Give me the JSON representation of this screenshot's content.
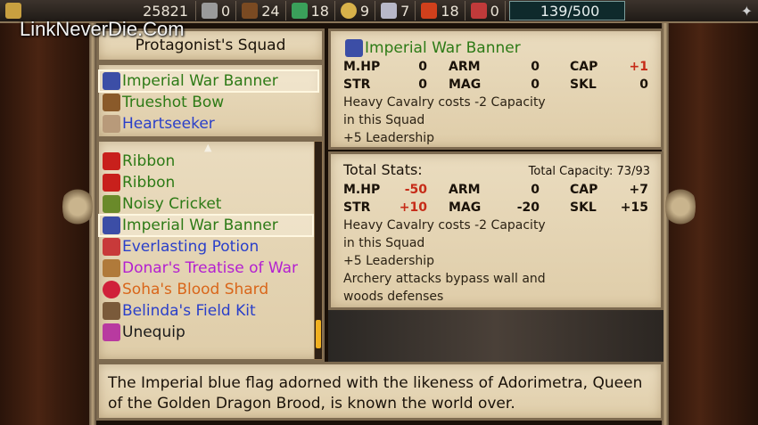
{
  "watermark": "LinkNeverDie.Com",
  "topbar": {
    "gold": "25821",
    "res1": "0",
    "res2": "24",
    "res3": "18",
    "res4": "9",
    "res5": "7",
    "res6": "18",
    "res7": "0",
    "capacity": "139/500"
  },
  "squad_title": "Protagonist's Squad",
  "equipped": [
    {
      "name": "Imperial War Banner"
    },
    {
      "name": "Trueshot Bow"
    },
    {
      "name": "Heartseeker"
    }
  ],
  "inventory": [
    {
      "name": "Ribbon"
    },
    {
      "name": "Ribbon"
    },
    {
      "name": "Noisy Cricket"
    },
    {
      "name": "Imperial War Banner"
    },
    {
      "name": "Everlasting Potion"
    },
    {
      "name": "Donar's Treatise of War"
    },
    {
      "name": "Soha's Blood Shard"
    },
    {
      "name": "Belinda's Field Kit"
    },
    {
      "name": "Unequip"
    }
  ],
  "item_detail": {
    "name": "Imperial War Banner",
    "stats": {
      "mhp_label": "M.HP",
      "mhp": "0",
      "arm_label": "ARM",
      "arm": "0",
      "cap_label": "CAP",
      "cap": "+1",
      "str_label": "STR",
      "str": "0",
      "mag_label": "MAG",
      "mag": "0",
      "skl_label": "SKL",
      "skl": "0"
    },
    "line1": "Heavy Cavalry costs -2 Capacity",
    "line2": "in this Squad",
    "line3": "+5 Leadership"
  },
  "total": {
    "title": "Total Stats:",
    "capacity": "Total Capacity: 73/93",
    "stats": {
      "mhp_label": "M.HP",
      "mhp": "-50",
      "arm_label": "ARM",
      "arm": "0",
      "cap_label": "CAP",
      "cap": "+7",
      "str_label": "STR",
      "str": "+10",
      "mag_label": "MAG",
      "mag": "-20",
      "skl_label": "SKL",
      "skl": "+15"
    },
    "line1": "Heavy Cavalry costs -2 Capacity",
    "line2": "in this Squad",
    "line3": "+5 Leadership",
    "line4": "Archery attacks bypass wall and",
    "line5": "woods defenses"
  },
  "description": {
    "line1": "The Imperial blue flag adorned with the likeness of Adorimetra, Queen",
    "line2": "of the Golden Dragon Brood, is known the world over."
  },
  "colors": {
    "green": "#2d7a16",
    "blue": "#2a3fc9",
    "purple": "#b31fd1",
    "orange": "#d9661a",
    "red": "#c62b18"
  }
}
